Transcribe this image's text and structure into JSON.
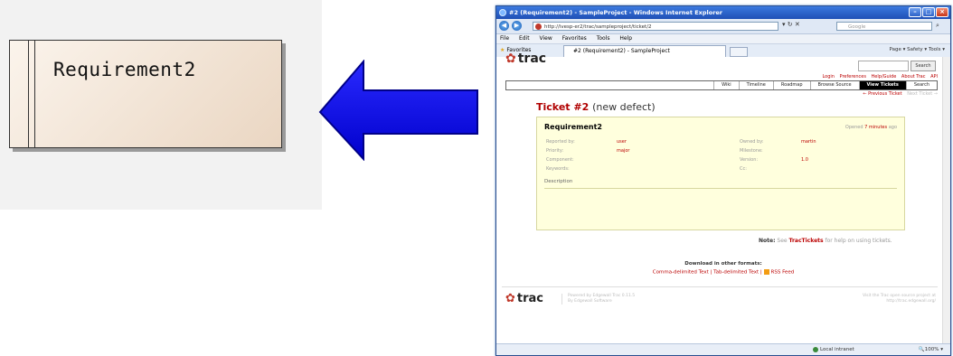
{
  "diagram": {
    "element_name": "Requirement2"
  },
  "browser": {
    "title": "#2 (Requirement2) - SampleProject - Windows Internet Explorer",
    "url": "http://ivesp-er2/trac/sampleproject/ticket/2",
    "search_placeholder": "Google",
    "menu": [
      "File",
      "Edit",
      "View",
      "Favorites",
      "Tools",
      "Help"
    ],
    "favorites_label": "Favorites",
    "tab_title": "#2 (Requirement2) - SampleProject",
    "toolbar_tools": "Page ▾  Safety ▾  Tools ▾",
    "status_zone": "Local intranet",
    "status_zoom": "100%"
  },
  "trac": {
    "logo": "trac",
    "search_button": "Search",
    "metanav": [
      "Login",
      "Preferences",
      "Help/Guide",
      "About Trac",
      "API"
    ],
    "mainnav": [
      "Wiki",
      "Timeline",
      "Roadmap",
      "Browse Source",
      "View Tickets",
      "Search"
    ],
    "active_nav": "View Tickets",
    "prev_ticket": "← Previous Ticket",
    "next_ticket": "Next Ticket →",
    "ticket_number": "Ticket #2",
    "ticket_status": "(new defect)",
    "summary": "Requirement2",
    "opened_prefix": "Opened",
    "opened_age": "7 minutes",
    "opened_suffix": "ago",
    "props": {
      "reported_by_label": "Reported by:",
      "reported_by": "user",
      "owned_by_label": "Owned by:",
      "owned_by": "martin",
      "priority_label": "Priority:",
      "priority": "major",
      "milestone_label": "Milestone:",
      "milestone": "",
      "component_label": "Component:",
      "component": "",
      "version_label": "Version:",
      "version": "1.0",
      "keywords_label": "Keywords:",
      "keywords": "",
      "cc_label": "Cc:",
      "cc": ""
    },
    "description_label": "Description",
    "note_prefix": "Note:",
    "note_see": "See",
    "note_link": "TracTickets",
    "note_suffix": "for help on using tickets.",
    "download_title": "Download in other formats:",
    "format_csv": "Comma-delimited Text",
    "format_tab": "Tab-delimited Text",
    "format_rss": "RSS Feed",
    "footer_info_1": "Powered by Edgewall Trac 0.11.5",
    "footer_info_2": "By Edgewall Software",
    "footer_right_1": "Visit the Trac open source project at",
    "footer_right_2": "http://trac.edgewall.org/"
  },
  "colors": {
    "arrow_fill": "#0000ff",
    "element_fill": "#ead6c2",
    "trac_link": "#b00000"
  }
}
